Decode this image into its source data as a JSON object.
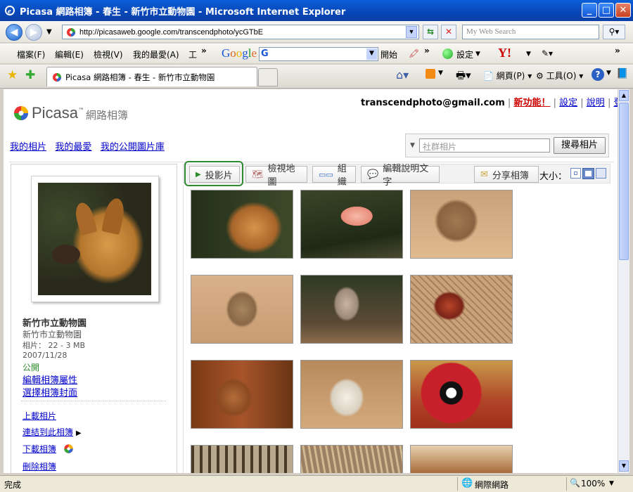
{
  "window": {
    "title": "Picasa 網路相簿 - 春生 - 新竹市立動物園 - Microsoft Internet Explorer",
    "min": "_",
    "max": "□",
    "close": "✕"
  },
  "address": {
    "url": "http://picasaweb.google.com/transcendphoto/ycGTbE",
    "search_placeholder": "My Web Search"
  },
  "menu": {
    "items": [
      "檔案(F)",
      "編輯(E)",
      "檢視(V)",
      "我的最愛(A)",
      "工"
    ],
    "more": "»",
    "google": "Google",
    "g_letter": "G",
    "start": "開始",
    "settings": "設定"
  },
  "tab": {
    "title": "Picasa 網路相簿 - 春生 - 新竹市立動物園",
    "webpage": "網頁(P)",
    "tools": "工具(O)"
  },
  "page": {
    "email": "transcendphoto@gmail.com",
    "new_features": "新功能！",
    "settings": "設定",
    "help": "說明",
    "logout": "登出",
    "logo_word": "Picasa",
    "logo_tm": "™",
    "logo_suffix": "網路相簿",
    "nav": [
      "我的相片",
      "我的最愛",
      "我的公開圖片庫"
    ],
    "search_placeholder": "社群相片",
    "search_button": "搜尋相片",
    "toolbar": {
      "slideshow": "投影片",
      "map": "檢視地圖",
      "organize": "組織",
      "edit_captions": "編輯說明文字",
      "share": "分享相簿",
      "size_label": "大小："
    },
    "album": {
      "title": "新竹市立動物園",
      "location": "新竹市立動物園",
      "photo_count": "相片： 22 - 3 MB",
      "date": "2007/11/28",
      "visibility": "公開",
      "edit_props": "編輯相簿屬性",
      "choose_cover": "選擇相簿封面",
      "upload": "上載相片",
      "link": "連結到此相簿",
      "download": "下載相簿",
      "delete": "刪除相簿"
    },
    "photos": [
      "dog",
      "flamingo",
      "monkeys",
      "macaque",
      "baboon",
      "pheasant",
      "deer",
      "white-peacock",
      "golden-pheasant",
      "row4-1",
      "row4-2",
      "row4-3"
    ]
  },
  "status": {
    "text": "完成",
    "zone": "網際網路",
    "zoom": "100%"
  }
}
